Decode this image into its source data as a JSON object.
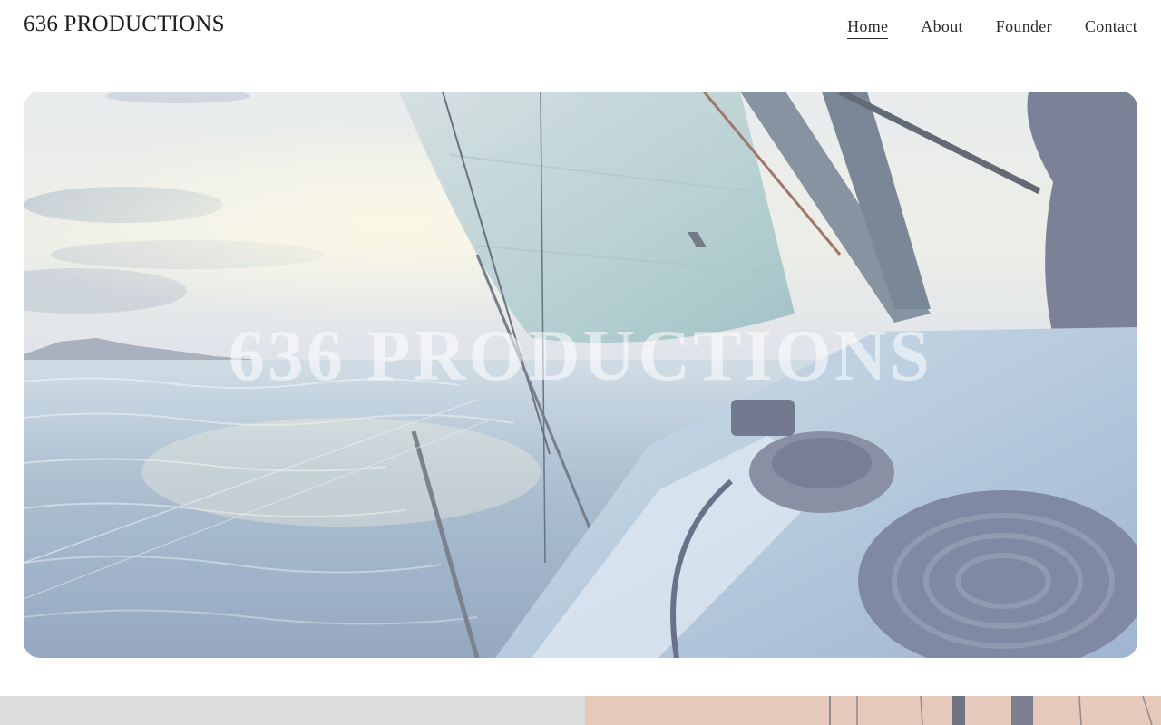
{
  "header": {
    "site_title": "636 PRODUCTIONS",
    "nav": [
      {
        "label": "Home",
        "active": true
      },
      {
        "label": "About",
        "active": false
      },
      {
        "label": "Founder",
        "active": false
      },
      {
        "label": "Contact",
        "active": false
      }
    ]
  },
  "hero": {
    "title": "636 PRODUCTIONS",
    "image": "sailboat-bow-on-ocean-at-sunset"
  },
  "colors": {
    "text": "#222222",
    "hero_title": "rgba(255,255,255,0.55)",
    "strip_left": "#dcdcdc",
    "strip_right": "#e6c9bb"
  }
}
